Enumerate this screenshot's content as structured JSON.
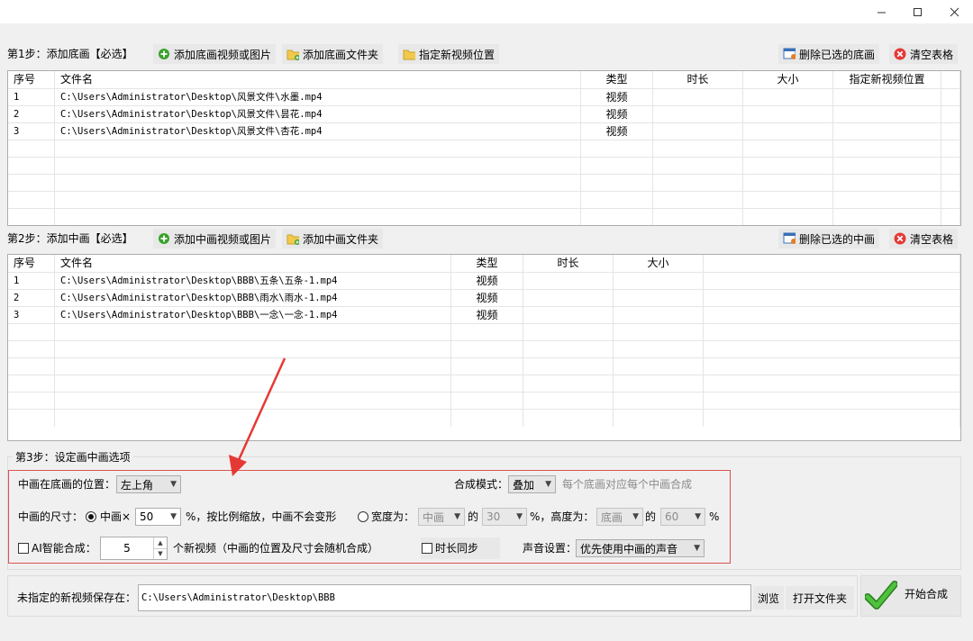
{
  "window": {
    "minimize_icon": "minimize-icon",
    "maximize_icon": "maximize-icon",
    "close_icon": "close-icon"
  },
  "step1": {
    "title": "第1步：添加底画【必选】",
    "add_media_label": "添加底画视频或图片",
    "add_folder_label": "添加底画文件夹",
    "set_location_label": "指定新视频位置",
    "delete_label": "删除已选的底画",
    "clear_label": "清空表格",
    "columns": [
      "序号",
      "文件名",
      "类型",
      "时长",
      "大小",
      "指定新视频位置"
    ],
    "rows": [
      {
        "index": "1",
        "file": "C:\\Users\\Administrator\\Desktop\\风景文件\\水墨.mp4",
        "type": "视频"
      },
      {
        "index": "2",
        "file": "C:\\Users\\Administrator\\Desktop\\风景文件\\昙花.mp4",
        "type": "视频"
      },
      {
        "index": "3",
        "file": "C:\\Users\\Administrator\\Desktop\\风景文件\\杏花.mp4",
        "type": "视频"
      }
    ]
  },
  "step2": {
    "title": "第2步：添加中画【必选】",
    "add_media_label": "添加中画视频或图片",
    "add_folder_label": "添加中画文件夹",
    "delete_label": "删除已选的中画",
    "clear_label": "清空表格",
    "columns": [
      "序号",
      "文件名",
      "类型",
      "时长",
      "大小"
    ],
    "rows": [
      {
        "index": "1",
        "file": "C:\\Users\\Administrator\\Desktop\\BBB\\五条\\五条-1.mp4",
        "type": "视频"
      },
      {
        "index": "2",
        "file": "C:\\Users\\Administrator\\Desktop\\BBB\\雨水\\雨水-1.mp4",
        "type": "视频"
      },
      {
        "index": "3",
        "file": "C:\\Users\\Administrator\\Desktop\\BBB\\一念\\一念-1.mp4",
        "type": "视频"
      }
    ]
  },
  "step3": {
    "title": "第3步：设定画中画选项",
    "position_label": "中画在底画的位置：",
    "position_value": "左上角",
    "blend_mode_label": "合成模式：",
    "blend_mode_value": "叠加",
    "blend_mode_hint": "每个底画对应每个中画合成",
    "size_label": "中画的尺寸：",
    "ratio_option_label": "中画×",
    "ratio_value": "50",
    "ratio_suffix": "%，按比例缩放，中画不会变形",
    "width_option_label": "宽度为：",
    "width_ref": "中画",
    "of_label_1": "的",
    "width_percent": "30",
    "height_label": "%，高度为：",
    "height_ref": "底画",
    "of_label_2": "的",
    "height_percent": "60",
    "percent_suffix": "%",
    "ai_label": "AI智能合成：",
    "ai_count": "5",
    "ai_suffix": "个新视频（中画的位置及尺寸会随机合成）",
    "duration_sync_label": "时长同步",
    "audio_label": "声音设置：",
    "audio_value": "优先使用中画的声音"
  },
  "output": {
    "label": "未指定的新视频保存在：",
    "path": "C:\\Users\\Administrator\\Desktop\\BBB",
    "browse_label": "浏览",
    "open_folder_label": "打开文件夹",
    "start_label": "开始合成"
  },
  "colors": {
    "annotation_red": "#e53935",
    "checkmark_green": "#3aa12c",
    "highlight_border": "#d9534f"
  }
}
